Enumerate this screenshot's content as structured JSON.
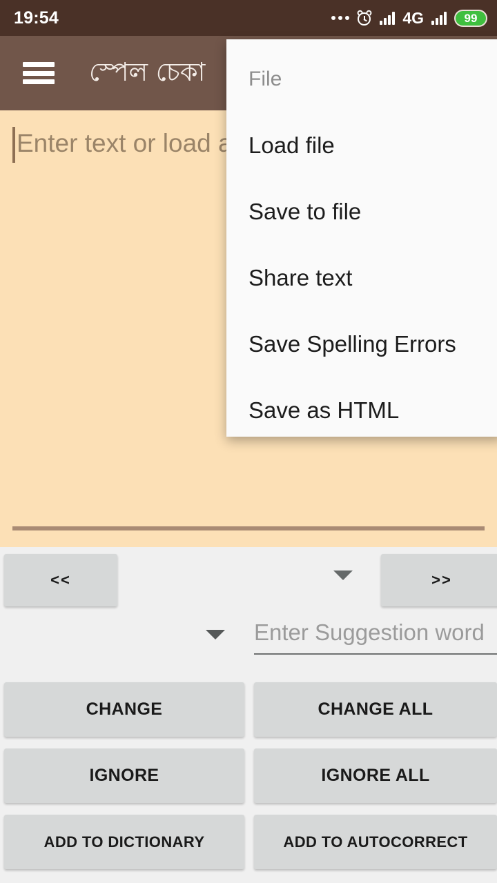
{
  "status_bar": {
    "clock": "19:54",
    "network_label": "4G",
    "battery_level": "99",
    "icons": [
      "more-dots-icon",
      "alarm-clock-icon",
      "signal-bars-icon",
      "signal-bars-icon",
      "battery-icon"
    ],
    "background_color": "#4A3127"
  },
  "app_bar": {
    "menu_icon": "hamburger-menu-icon",
    "title": "স্পেল চেকা",
    "background_color": "#71564A"
  },
  "editor": {
    "placeholder": "Enter text or load a",
    "value": "",
    "background_color": "#FCE0B6",
    "divider_color": "#A98B74"
  },
  "file_menu": {
    "header": "File",
    "items": [
      {
        "label": "Load file"
      },
      {
        "label": "Save to file"
      },
      {
        "label": "Share text"
      },
      {
        "label": "Save Spelling Errors"
      },
      {
        "label": "Save as HTML"
      }
    ],
    "background_color": "#FAFAFA"
  },
  "controls": {
    "prev_label": "<<",
    "next_label": ">>",
    "word_dropdown_icon": "chevron-down-icon",
    "suggestion_dropdown_icon": "chevron-down-icon",
    "suggestion_placeholder": "Enter Suggestion word",
    "suggestion_value": "",
    "actions": [
      {
        "left": "CHANGE",
        "right": "CHANGE ALL"
      },
      {
        "left": "IGNORE",
        "right": "IGNORE ALL"
      },
      {
        "left": "ADD TO DICTIONARY",
        "right": "ADD TO AUTOCORRECT"
      }
    ],
    "button_color": "#D6D8D8",
    "panel_color": "#F0F0F0"
  }
}
